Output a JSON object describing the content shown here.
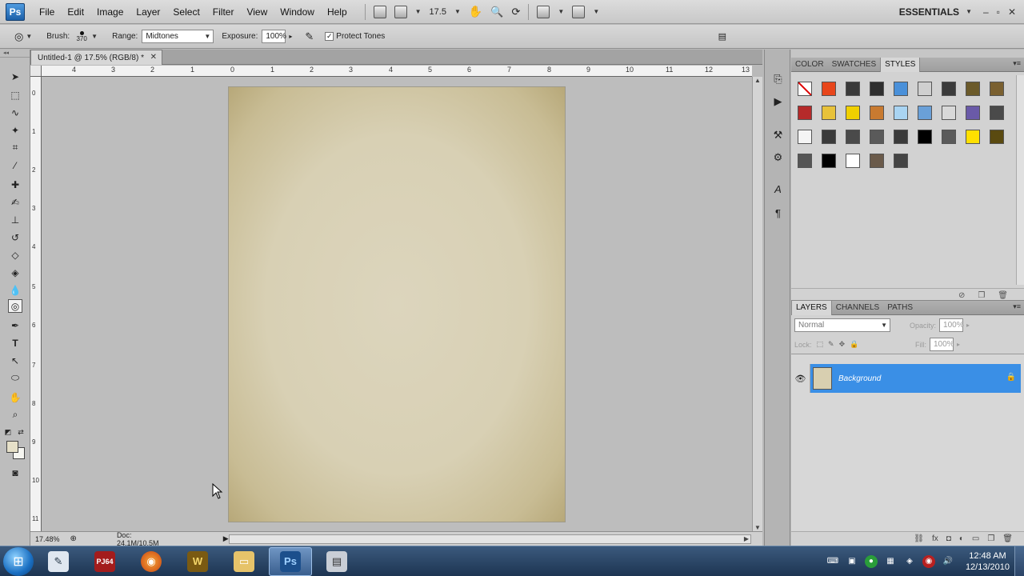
{
  "app": {
    "logo": "Ps",
    "menu": [
      "File",
      "Edit",
      "Image",
      "Layer",
      "Select",
      "Filter",
      "View",
      "Window",
      "Help"
    ],
    "zoom_value": "17.5",
    "workspace": "ESSENTIALS",
    "window_controls": [
      "–",
      "▫",
      "✕"
    ]
  },
  "options": {
    "brush_label": "Brush:",
    "brush_size": "370",
    "range_label": "Range:",
    "range_value": "Midtones",
    "exposure_label": "Exposure:",
    "exposure_value": "100%",
    "protect_tones_label": "Protect Tones",
    "protect_tones_checked": "✓"
  },
  "document": {
    "tab_title": "Untitled-1 @ 17.5% (RGB/8) *",
    "close_glyph": "✕",
    "paper_color": "#d9d1b6"
  },
  "rulers": {
    "top": [
      "4",
      "3",
      "2",
      "1",
      "0",
      "1",
      "2",
      "3",
      "4",
      "5",
      "6",
      "7",
      "8",
      "9",
      "10",
      "11",
      "12",
      "13"
    ],
    "left": [
      "0",
      "1",
      "2",
      "3",
      "4",
      "5",
      "6",
      "7",
      "8",
      "9",
      "10",
      "11"
    ]
  },
  "status": {
    "zoom": "17.48%",
    "doc": "Doc: 24.1M/10.5M"
  },
  "panels": {
    "top_tabs": [
      "COLOR",
      "SWATCHES",
      "STYLES"
    ],
    "layer_tabs": [
      "LAYERS",
      "CHANNELS",
      "PATHS"
    ],
    "blend_mode": "Normal",
    "opacity_label": "Opacity:",
    "opacity_value": "100%",
    "lock_label": "Lock:",
    "fill_label": "Fill:",
    "fill_value": "100%",
    "layer_name": "Background"
  },
  "styles_swatches": [
    "#ffffff",
    "#e8461b",
    "#3a3a3a",
    "#2e2e2e",
    "#4a90d9",
    "#cfcfcf",
    "#3b3b3b",
    "#6b5a2a",
    "#7a6030",
    "#b52a2a",
    "#e8c23a",
    "#f0d000",
    "#c87a30",
    "#a9d4f2",
    "#6aa0d8",
    "#d8d8d8",
    "#6a5aa8",
    "#4a4a4a",
    "#f4f4f4",
    "#3a3a3a",
    "#4a4a4a",
    "#5a5a5a",
    "#3a3a3a",
    "#000000",
    "#5a5a5a",
    "#ffe000",
    "#5a4a10",
    "#555555",
    "#000000",
    "#ffffff",
    "#6a5a4a",
    "#444444"
  ],
  "taskbar": {
    "apps": [
      "PJ64",
      "Firefox",
      "Warcraft",
      "Explorer",
      "Ps",
      "Video"
    ],
    "time": "12:48 AM",
    "date": "12/13/2010"
  }
}
